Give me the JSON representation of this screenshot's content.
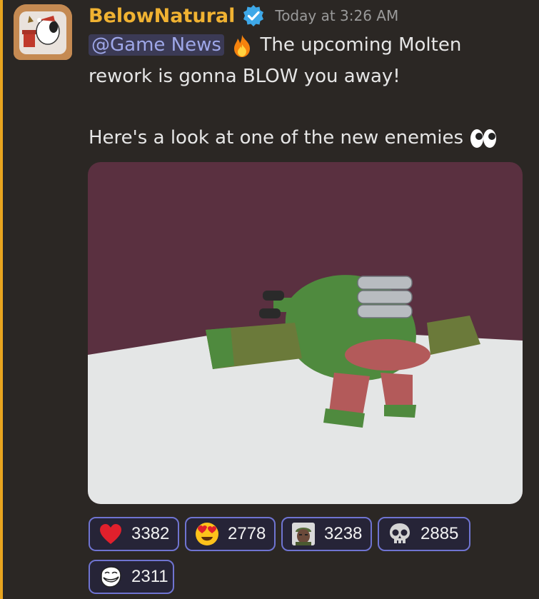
{
  "message": {
    "author": "BelowNatural",
    "verified": true,
    "timestamp": "Today at 3:26 AM",
    "mention": "@Game News",
    "text_line1": "The upcoming Molten",
    "text_line2": "rework is gonna BLOW you away!",
    "text_line3": "Here's a look at one of the new enemies",
    "emojis": [
      "fire",
      "eyes"
    ],
    "attachment": "image"
  },
  "reactions": [
    {
      "emoji": "red-heart",
      "count": "3382"
    },
    {
      "emoji": "heart-eyes",
      "count": "2778"
    },
    {
      "emoji": "custom-soldier",
      "count": "3238"
    },
    {
      "emoji": "skull",
      "count": "2885"
    },
    {
      "emoji": "troll-face",
      "count": "2311"
    }
  ],
  "colors": {
    "background": "#2b2724",
    "username": "#f0b232",
    "accent_bar": "#e8a41f",
    "reaction_border": "#6f74d1",
    "mention_bg": "#3b3a55",
    "mention_text": "#9ea7e8"
  }
}
